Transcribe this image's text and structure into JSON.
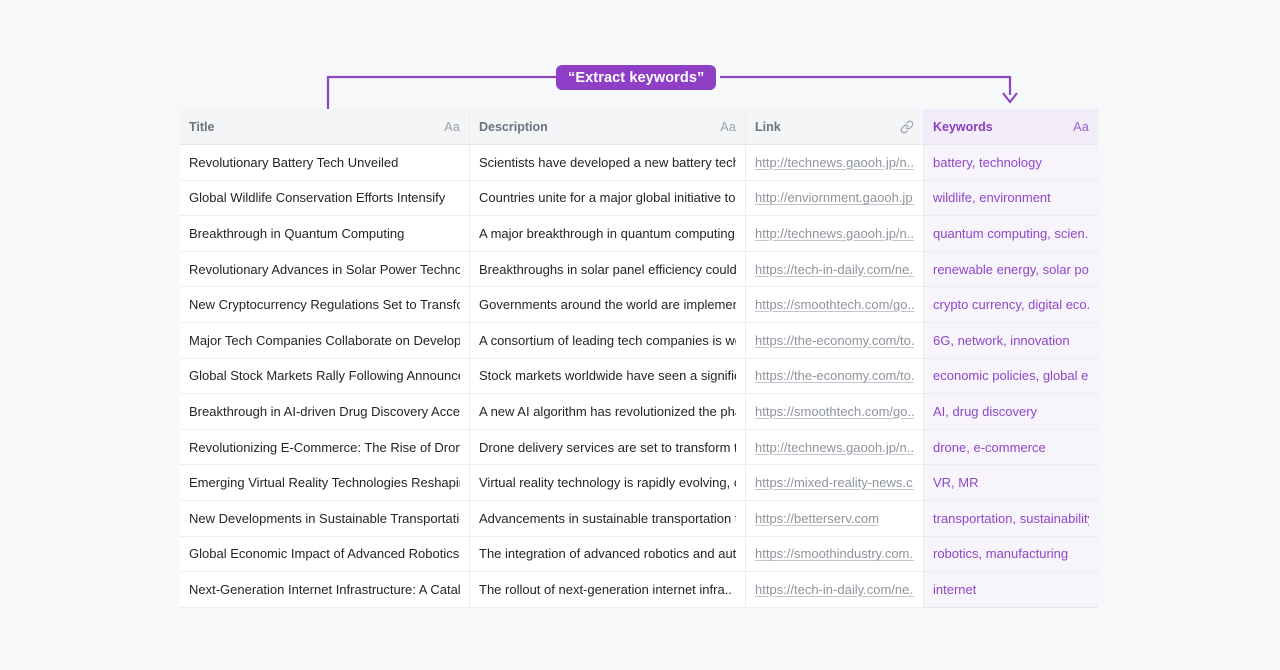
{
  "callout": {
    "label": "“Extract keywords”",
    "accent_color": "#8E3FC6",
    "line_color": "#8B47C2"
  },
  "table": {
    "columns": [
      {
        "key": "title",
        "label": "Title",
        "icon": "text-aa-icon",
        "icon_label": "Aa"
      },
      {
        "key": "description",
        "label": "Description",
        "icon": "text-aa-icon",
        "icon_label": "Aa"
      },
      {
        "key": "link",
        "label": "Link",
        "icon": "link-chain-icon",
        "icon_label": ""
      },
      {
        "key": "keywords",
        "label": "Keywords",
        "icon": "text-aa-icon",
        "icon_label": "Aa"
      }
    ],
    "highlight_column": "keywords",
    "highlight_bg": "#F7F4FB",
    "highlight_text": "#9046C8",
    "rows": [
      {
        "title": "Revolutionary Battery Tech Unveiled",
        "description": "Scientists have developed a new battery tech..",
        "link": "http://technews.gaooh.jp/n..",
        "keywords": "battery, technology"
      },
      {
        "title": "Global Wildlife Conservation Efforts Intensify",
        "description": "Countries unite for a major global initiative to..",
        "link": "http://enviornment.gaooh.jp..",
        "keywords": "wildlife, environment"
      },
      {
        "title": "Breakthrough in Quantum Computing",
        "description": "A major breakthrough in quantum computing ..",
        "link": "http://technews.gaooh.jp/n..",
        "keywords": "quantum computing, scien.."
      },
      {
        "title": "Revolutionary Advances in Solar Power Technol..",
        "description": "Breakthroughs in solar panel efficiency could l..",
        "link": "https://tech-in-daily.com/ne..",
        "keywords": "renewable energy, solar po.."
      },
      {
        "title": "New Cryptocurrency Regulations Set to Transfor..",
        "description": "Governments around the world are implement..",
        "link": "https://smoothtech.com/go..",
        "keywords": "crypto currency, digital eco.."
      },
      {
        "title": "Major Tech Companies Collaborate on Developin..",
        "description": "A consortium of leading tech companies is wo..",
        "link": "https://the-economy.com/to..",
        "keywords": "6G, network, innovation"
      },
      {
        "title": "Global Stock Markets Rally Following Announce..",
        "description": "Stock markets worldwide have seen a signific..",
        "link": "https://the-economy.com/to..",
        "keywords": "economic policies, global e.."
      },
      {
        "title": "Breakthrough in AI-driven Drug Discovery  Accele..",
        "description": "A new AI algorithm has revolutionized the phar..",
        "link": "https://smoothtech.com/go..",
        "keywords": "AI, drug discovery"
      },
      {
        "title": "Revolutionizing E-Commerce: The Rise of Drone ..",
        "description": "Drone delivery services are set to transform th..",
        "link": "http://technews.gaooh.jp/n..",
        "keywords": "drone, e-commerce"
      },
      {
        "title": "Emerging Virtual Reality Technologies Reshapin..",
        "description": "Virtual reality technology is rapidly evolving, of..",
        "link": "https://mixed-reality-news.c..",
        "keywords": "VR, MR"
      },
      {
        "title": "New Developments in Sustainable Transportatio..",
        "description": "Advancements in sustainable transportation t..",
        "link": "https://betterserv.com",
        "keywords": "transportation, sustainability"
      },
      {
        "title": "Global Economic Impact of Advanced Robotics ..",
        "description": "The integration of advanced robotics and auto..",
        "link": "https://smoothindustry.com..",
        "keywords": "robotics, manufacturing"
      },
      {
        "title": "Next-Generation Internet Infrastructure: A Cataly..",
        "description": "The rollout of next-generation internet infra..",
        "link": "https://tech-in-daily.com/ne..",
        "keywords": "internet"
      }
    ]
  }
}
